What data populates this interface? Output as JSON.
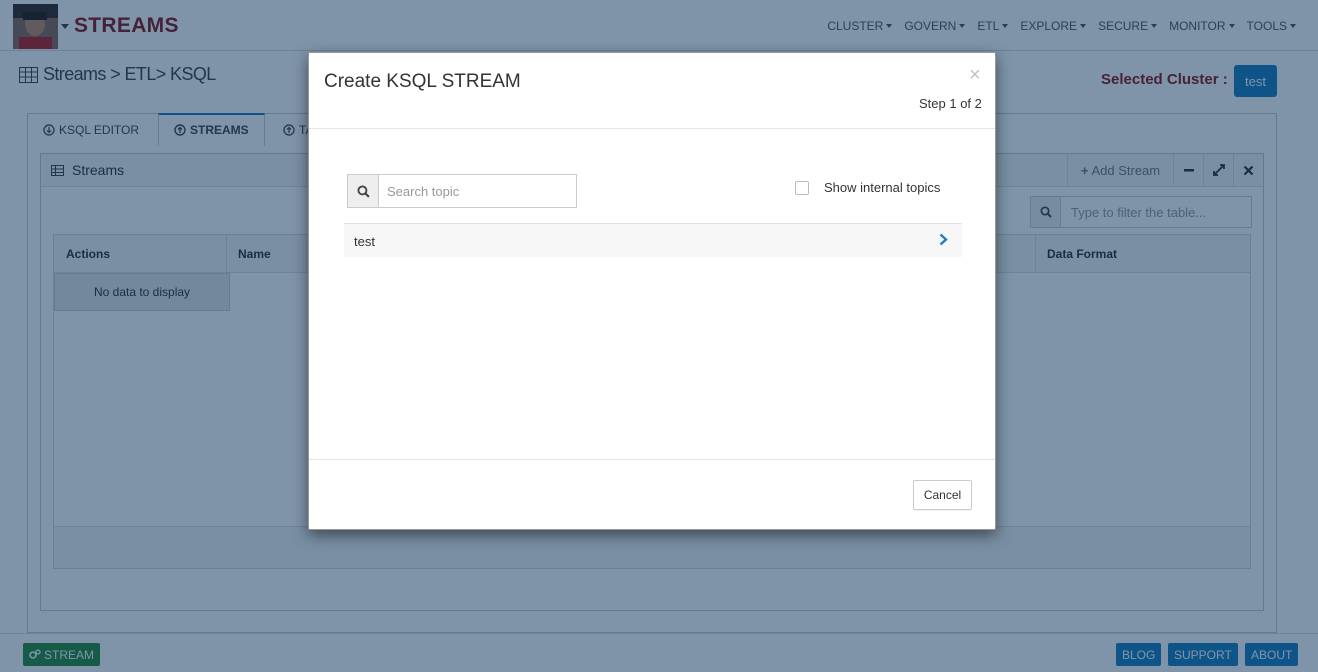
{
  "app": {
    "brand": "STREAMS",
    "menu": [
      "CLUSTER",
      "GOVERN",
      "ETL",
      "EXPLORE",
      "SECURE",
      "MONITOR",
      "TOOLS"
    ]
  },
  "breadcrumb": "Streams > ETL> KSQL",
  "cluster": {
    "label": "Selected Cluster :",
    "value": "test"
  },
  "tabs": {
    "ksql_editor": "KSQL EDITOR",
    "streams": "STREAMS",
    "tables_partial": "TA"
  },
  "widget": {
    "title": "Streams",
    "add_stream": "Add Stream",
    "filter_placeholder": "Type to filter the table..."
  },
  "grid": {
    "columns": {
      "actions": "Actions",
      "name": "Name",
      "data_format": "Data Format"
    },
    "empty": "No data to display"
  },
  "footer": {
    "stream_badge": "STREAM",
    "blog": "BLOG",
    "support": "SUPPORT",
    "about": "ABOUT"
  },
  "modal": {
    "title": "Create KSQL STREAM",
    "close": "×",
    "step": "Step 1 of 2",
    "search_placeholder": "Search topic",
    "show_internal_label": "Show internal topics",
    "topics": [
      {
        "name": "test"
      }
    ],
    "cancel": "Cancel"
  },
  "colors": {
    "brand": "#8b1a1a",
    "accent": "#1f7fbf",
    "stream_badge": "#2e8b3a"
  }
}
